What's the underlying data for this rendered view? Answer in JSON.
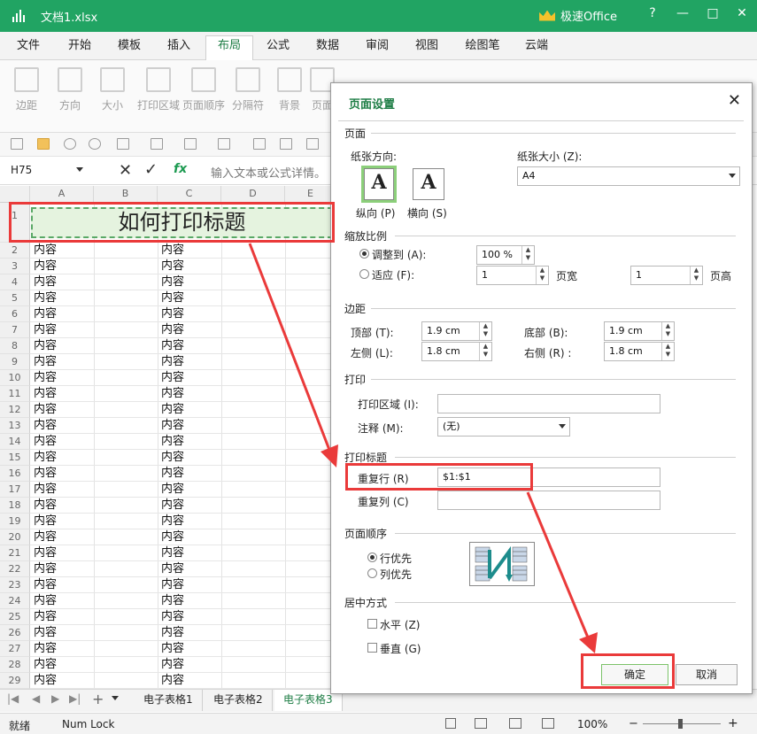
{
  "titlebar": {
    "title": "文档1.xlsx",
    "brand": "极速Office",
    "help": "?",
    "minimize": "—",
    "maximize": "□",
    "close": "✕"
  },
  "menu": [
    "文件",
    "开始",
    "模板",
    "插入",
    "布局",
    "公式",
    "数据",
    "审阅",
    "视图",
    "绘图笔",
    "云端"
  ],
  "ribbon": [
    "边距",
    "方向",
    "大小",
    "打印区域",
    "页面顺序",
    "分隔符",
    "背景",
    "页面"
  ],
  "formula": {
    "cellref": "H75",
    "fx": "fx",
    "placeholder": "输入文本或公式详情。"
  },
  "grid": {
    "columns": [
      "A",
      "B",
      "C",
      "D",
      "E"
    ],
    "title": "如何打印标题",
    "cell_text": "内容"
  },
  "sheets": [
    "电子表格1",
    "电子表格2",
    "电子表格3"
  ],
  "status": {
    "ready": "就绪",
    "numlock": "Num Lock",
    "zoom": "100%"
  },
  "dialog": {
    "title": "页面设置",
    "page_section": "页面",
    "orientation_label": "纸张方向:",
    "portrait": "纵向 (P)",
    "landscape": "横向 (S)",
    "paper_size_label": "纸张大小 (Z):",
    "paper_size": "A4",
    "scale_section": "缩放比例",
    "fit_to": "调整到 (A):",
    "fit_to_value": "100 %",
    "fit": "适应 (F):",
    "fit_wide_value": "1",
    "pages_wide": "页宽",
    "fit_tall_value": "1",
    "pages_tall": "页高",
    "margins_section": "边距",
    "top": "顶部 (T):",
    "top_value": "1.9 cm",
    "bottom": "底部 (B):",
    "bottom_value": "1.9 cm",
    "left": "左侧 (L):",
    "left_value": "1.8 cm",
    "right": "右侧 (R) :",
    "right_value": "1.8 cm",
    "print_section": "打印",
    "print_area": "打印区域 (I):",
    "print_area_value": "",
    "comments": "注释 (M):",
    "comments_value": "(无)",
    "print_titles_section": "打印标题",
    "repeat_rows": "重复行 (R)",
    "repeat_rows_value": "$1:$1",
    "repeat_cols": "重复列 (C)",
    "repeat_cols_value": "",
    "page_order_section": "页面顺序",
    "row_first": "行优先",
    "col_first": "列优先",
    "center_section": "居中方式",
    "horizontal": "水平 (Z)",
    "vertical": "垂直 (G)",
    "ok": "确定",
    "cancel": "取消"
  },
  "colors": {
    "brand_green": "#21a463",
    "accent_red": "#ea3a3a"
  }
}
